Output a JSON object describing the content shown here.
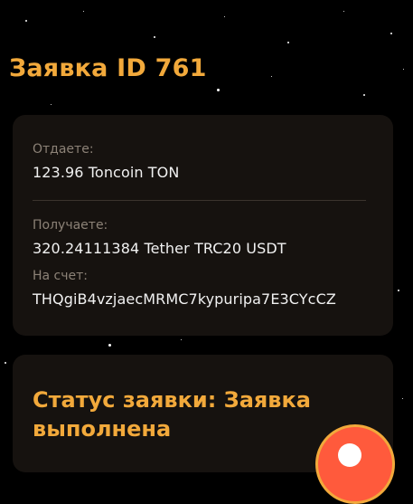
{
  "page": {
    "title": "Заявка ID 761"
  },
  "order": {
    "give_label": "Отдаете:",
    "give_value": "123.96 Toncoin TON",
    "receive_label": "Получаете:",
    "receive_value": "320.24111384 Tether TRC20 USDT",
    "account_label": "На счет:",
    "account_value": "THQgiB4vzjaecMRMC7kypuripa7E3CYcCZ"
  },
  "status": {
    "text": "Статус заявки: Заявка выполнена"
  },
  "colors": {
    "accent": "#f2a93b",
    "background": "#000000",
    "card": "#181411",
    "action": "#ff5a3c"
  }
}
